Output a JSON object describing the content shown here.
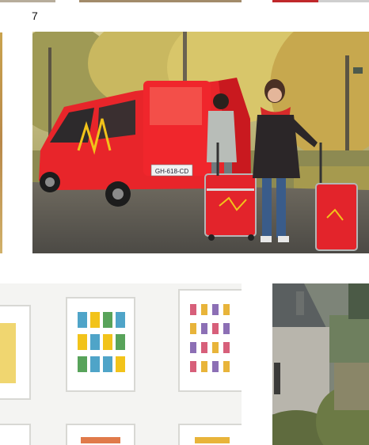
{
  "gallery": {
    "counter": "7",
    "main_photo": {
      "plate": "GH-618-CD"
    },
    "colors": {
      "van_red": "#e8252a",
      "suitcase_red": "#e3242b",
      "logo_yellow": "#f2c31a",
      "foliage": "#c8b45a",
      "scarf_red": "#d62a2a",
      "jeans_blue": "#3a5c8a",
      "wall": "#f4f4f2"
    },
    "icons": [
      "van-logo-icon"
    ]
  }
}
